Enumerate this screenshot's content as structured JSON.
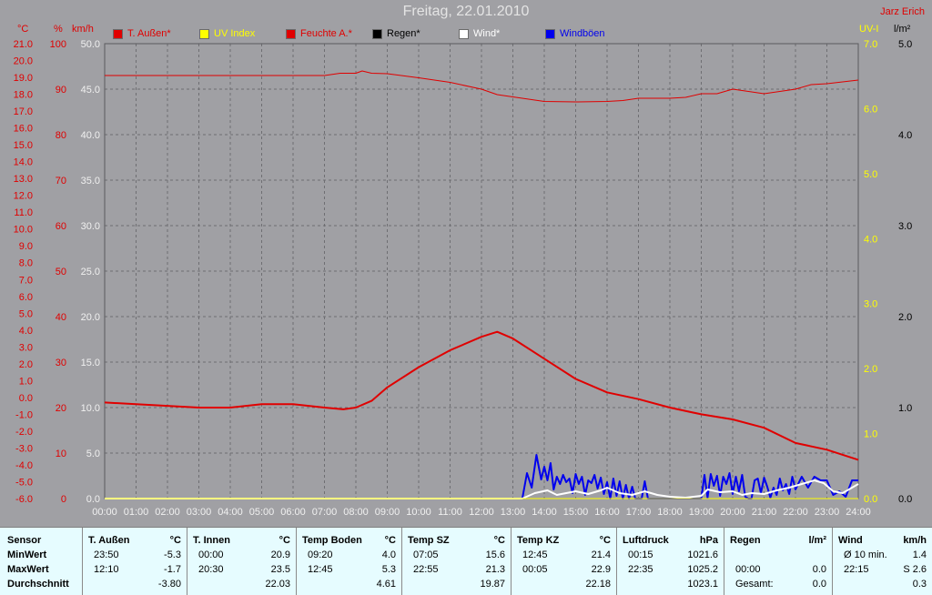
{
  "title": "Freitag, 22.01.2010",
  "author": "Jarz Erich",
  "units": {
    "celsius": "°C",
    "percent": "%",
    "kmh": "km/h",
    "uv": "UV-I",
    "rain": "l/m²"
  },
  "legend": [
    {
      "label": "T. Außen*",
      "color": "#e00000"
    },
    {
      "label": "UV Index",
      "color": "#ffff00"
    },
    {
      "label": "Feuchte A.*",
      "color": "#e00000"
    },
    {
      "label": "Regen*",
      "color": "#000000"
    },
    {
      "label": "Wind*",
      "color": "#ffffff"
    },
    {
      "label": "Windböen",
      "color": "#0000ee"
    }
  ],
  "chart_data": {
    "type": "line",
    "title": "Freitag, 22.01.2010",
    "x": {
      "ticks": [
        "00:00",
        "01:00",
        "02:00",
        "03:00",
        "04:00",
        "05:00",
        "06:00",
        "07:00",
        "08:00",
        "09:00",
        "10:00",
        "11:00",
        "12:00",
        "13:00",
        "14:00",
        "15:00",
        "16:00",
        "17:00",
        "18:00",
        "19:00",
        "20:00",
        "21:00",
        "22:00",
        "23:00",
        "24:00"
      ],
      "range_hours": [
        0,
        24
      ]
    },
    "axes": {
      "temperature_c": {
        "range": [
          -6,
          21
        ],
        "ticks": [
          "21.0",
          "20.0",
          "19.0",
          "18.0",
          "17.0",
          "16.0",
          "15.0",
          "14.0",
          "13.0",
          "12.0",
          "11.0",
          "10.0",
          "9.0",
          "8.0",
          "7.0",
          "6.0",
          "5.0",
          "4.0",
          "3.0",
          "2.0",
          "1.0",
          "0.0",
          "-1.0",
          "-2.0",
          "-3.0",
          "-4.0",
          "-5.0",
          "-6.0"
        ]
      },
      "humidity_pct": {
        "range": [
          0,
          100
        ],
        "ticks": [
          "100",
          "90",
          "80",
          "70",
          "60",
          "50",
          "40",
          "30",
          "20",
          "10",
          "0"
        ]
      },
      "wind_kmh": {
        "range": [
          0,
          50
        ],
        "ticks": [
          "50.0",
          "45.0",
          "40.0",
          "35.0",
          "30.0",
          "25.0",
          "20.0",
          "15.0",
          "10.0",
          "5.0",
          "0.0"
        ]
      },
      "uv_index": {
        "range": [
          0,
          7
        ],
        "ticks": [
          "7.0",
          "6.0",
          "5.0",
          "4.0",
          "3.0",
          "2.0",
          "1.0",
          "0.0"
        ]
      },
      "rain_lm2": {
        "range": [
          0,
          5
        ],
        "ticks": [
          "5.0",
          "4.0",
          "3.0",
          "2.0",
          "1.0",
          "0.0"
        ]
      }
    },
    "grid": true,
    "series": [
      {
        "name": "T. Außen*",
        "axis": "temperature_c",
        "color": "#e00000",
        "x": [
          0,
          1,
          2,
          3,
          4,
          5,
          6,
          7,
          7.6,
          8,
          8.5,
          9,
          10,
          11,
          12,
          12.5,
          13,
          14,
          15,
          16,
          17,
          18,
          19,
          20,
          21,
          22,
          23,
          24
        ],
        "y": [
          -0.3,
          -0.4,
          -0.5,
          -0.6,
          -0.6,
          -0.4,
          -0.4,
          -0.6,
          -0.7,
          -0.6,
          -0.2,
          0.6,
          1.8,
          2.8,
          3.6,
          3.9,
          3.5,
          2.3,
          1.1,
          0.3,
          -0.1,
          -0.6,
          -1.0,
          -1.3,
          -1.8,
          -2.7,
          -3.1,
          -3.7
        ]
      },
      {
        "name": "Feuchte A.*",
        "axis": "humidity_pct",
        "color": "#e00000",
        "x": [
          0,
          7,
          7.5,
          8,
          8.2,
          8.5,
          9,
          10,
          11,
          12,
          12.5,
          13,
          14,
          15,
          16,
          16.5,
          17,
          18,
          18.5,
          19,
          19.5,
          20,
          20.5,
          21,
          21.5,
          22,
          22.5,
          23,
          24
        ],
        "y": [
          93,
          93,
          93.5,
          93.5,
          94,
          93.5,
          93.4,
          92.5,
          91.5,
          90,
          88.8,
          88.3,
          87.3,
          87.2,
          87.3,
          87.5,
          88,
          88,
          88.2,
          89,
          89,
          90,
          89.5,
          89,
          89.5,
          90,
          91,
          91.2,
          92
        ]
      },
      {
        "name": "UV Index",
        "axis": "uv_index",
        "color": "#ffff00",
        "x": [
          0,
          24
        ],
        "y": [
          0,
          0
        ]
      },
      {
        "name": "Regen*",
        "axis": "rain_lm2",
        "color": "#000000",
        "x": [
          0,
          24
        ],
        "y": [
          0,
          0
        ]
      },
      {
        "name": "Wind*",
        "axis": "wind_kmh",
        "color": "#ffffff",
        "x": [
          0,
          13.3,
          13.7,
          14.1,
          14.4,
          14.7,
          15.0,
          15.4,
          15.8,
          16.0,
          16.4,
          16.8,
          17.2,
          17.6,
          18.0,
          18.5,
          19.0,
          19.2,
          19.6,
          20.0,
          20.3,
          20.6,
          21.0,
          21.4,
          21.8,
          22.2,
          22.6,
          22.9,
          23.2,
          23.5,
          23.8,
          24
        ],
        "y": [
          0,
          0,
          0.6,
          0.9,
          0.4,
          0.6,
          0.8,
          0.5,
          0.9,
          1.2,
          0.6,
          0.4,
          0.8,
          0.4,
          0.2,
          0.1,
          0.3,
          1.0,
          0.7,
          0.8,
          0.4,
          0.6,
          0.5,
          0.9,
          1.2,
          1.6,
          2.0,
          1.7,
          0.8,
          0.6,
          1.2,
          1.6
        ]
      },
      {
        "name": "Windböen",
        "axis": "wind_kmh",
        "color": "#0000ee",
        "x": [
          0,
          13.3,
          13.45,
          13.6,
          13.75,
          13.9,
          14.0,
          14.1,
          14.2,
          14.3,
          14.4,
          14.5,
          14.6,
          14.7,
          14.8,
          14.9,
          15.0,
          15.1,
          15.2,
          15.3,
          15.4,
          15.5,
          15.6,
          15.7,
          15.8,
          15.9,
          16.0,
          16.1,
          16.2,
          16.3,
          16.4,
          16.5,
          16.6,
          16.7,
          16.8,
          16.9,
          17.0,
          17.1,
          17.2,
          17.3,
          17.4,
          17.6,
          18.0,
          18.5,
          19.0,
          19.1,
          19.2,
          19.3,
          19.4,
          19.5,
          19.6,
          19.7,
          19.8,
          19.9,
          20.0,
          20.1,
          20.2,
          20.3,
          20.4,
          20.5,
          20.6,
          20.7,
          20.8,
          20.9,
          21.0,
          21.1,
          21.2,
          21.3,
          21.4,
          21.5,
          21.6,
          21.7,
          21.8,
          21.9,
          22.0,
          22.2,
          22.4,
          22.6,
          22.8,
          23.0,
          23.2,
          23.4,
          23.6,
          23.8,
          24
        ],
        "y": [
          0,
          0,
          2.8,
          1.2,
          4.8,
          2.1,
          3.5,
          2.0,
          3.9,
          1.0,
          2.4,
          1.6,
          2.6,
          1.8,
          2.2,
          0.6,
          2.7,
          1.6,
          2.4,
          0.4,
          2.0,
          1.7,
          2.6,
          1.1,
          2.3,
          0.5,
          1.8,
          0,
          2.2,
          0.3,
          1.9,
          0,
          1.5,
          0,
          1.3,
          0,
          0,
          0,
          1.9,
          0,
          0,
          0,
          0,
          0,
          0,
          2.6,
          0.1,
          2.7,
          1.4,
          2.5,
          0.3,
          2.4,
          1.6,
          2.8,
          0.5,
          2.4,
          0.8,
          2.6,
          0.2,
          0,
          0,
          2.0,
          2.2,
          0.6,
          2.3,
          1.3,
          0.1,
          1.2,
          0.4,
          2.2,
          0.9,
          1.6,
          0.5,
          2.4,
          1.0,
          2.4,
          1.2,
          2.4,
          2.0,
          2.0,
          0.4,
          0.8,
          0.2,
          2.0,
          2.0
        ]
      }
    ]
  },
  "table": {
    "row_labels": {
      "header": "Sensor",
      "min": "MinWert",
      "max": "MaxWert",
      "avg": "Durchschnitt"
    },
    "columns": [
      {
        "name": "T. Außen",
        "unit": "°C",
        "min_time": "23:50",
        "min_val": "-5.3",
        "max_time": "12:10",
        "max_val": "-1.7",
        "avg": "-3.80"
      },
      {
        "name": "T. Innen",
        "unit": "°C",
        "min_time": "00:00",
        "min_val": "20.9",
        "max_time": "20:30",
        "max_val": "23.5",
        "avg": "22.03"
      },
      {
        "name": "Temp Boden",
        "unit": "°C",
        "min_time": "09:20",
        "min_val": "4.0",
        "max_time": "12:45",
        "max_val": "5.3",
        "avg": "4.61"
      },
      {
        "name": "Temp SZ",
        "unit": "°C",
        "min_time": "07:05",
        "min_val": "15.6",
        "max_time": "22:55",
        "max_val": "21.3",
        "avg": "19.87"
      },
      {
        "name": "Temp KZ",
        "unit": "°C",
        "min_time": "12:45",
        "min_val": "21.4",
        "max_time": "00:05",
        "max_val": "22.9",
        "avg": "22.18"
      },
      {
        "name": "Luftdruck",
        "unit": "hPa",
        "min_time": "00:15",
        "min_val": "1021.6",
        "max_time": "22:35",
        "max_val": "1025.2",
        "avg": "1023.1"
      },
      {
        "name": "Regen",
        "unit": "l/m²",
        "min_time": "",
        "min_val": "",
        "max_time": "00:00",
        "max_val": "0.0",
        "avg_label": "Gesamt:",
        "avg": "0.0"
      },
      {
        "name": "Wind",
        "unit": "km/h",
        "min_time": "Ø 10 min.",
        "min_val": "1.4",
        "max_time": "22:15",
        "max_val": "S 2.6",
        "avg": "0.3"
      }
    ]
  }
}
